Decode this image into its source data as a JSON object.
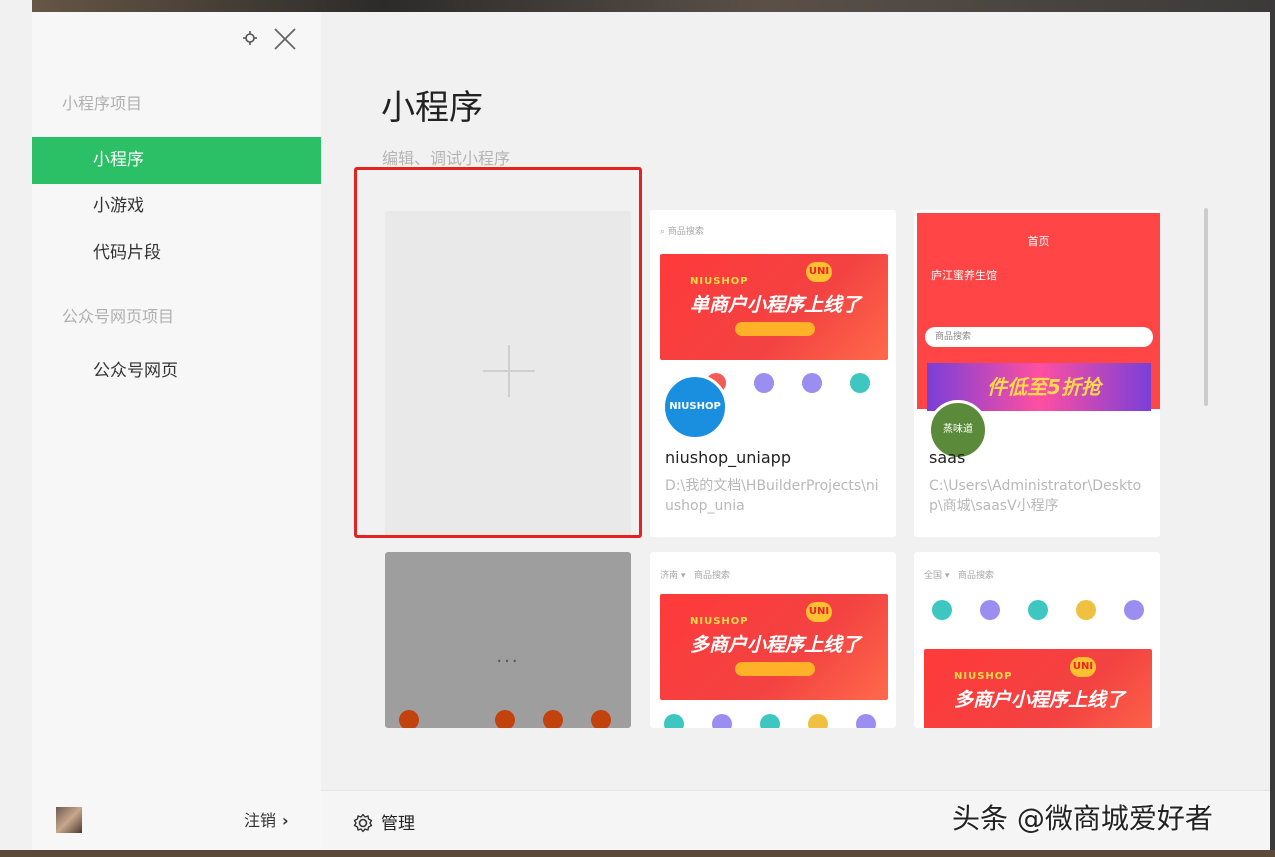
{
  "sidebar": {
    "section_mini": "小程序项目",
    "items": [
      {
        "label": "小程序"
      },
      {
        "label": "小游戏"
      },
      {
        "label": "代码片段"
      }
    ],
    "section_web": "公众号网页项目",
    "web_item": "公众号网页",
    "logout": "注销",
    "logout_chevron": "›"
  },
  "main": {
    "title": "小程序",
    "subtitle": "编辑、调试小程序",
    "projects": [
      {
        "name": "niushop_uniapp",
        "path": "D:\\我的文档\\HBuilderProjects\\niushop_unia",
        "logo": "NIUSHOP",
        "search": "商品搜索",
        "brand": "NIUSHOP",
        "banner": "单商户小程序上线了",
        "badge": "UNI"
      },
      {
        "name": "saas",
        "path": "C:\\Users\\Administrator\\Desktop\\商城\\saasV小程序",
        "header": "首页",
        "addr": "庐江蜜养生馆",
        "search": "商品搜索",
        "promo": "件低至5折抢",
        "logo": "蒸味道"
      }
    ],
    "loading_dots": "...",
    "multi_banner": "多商户小程序上线了",
    "multi_brand": "NIUSHOP",
    "multi_badge": "UNI",
    "multi_search_a": "商品搜索",
    "multi_loc_a": "济南",
    "multi_loc_b": "全国",
    "manage": "管理"
  },
  "watermark": "头条 @微商城爱好者",
  "colors": {
    "accent": "#2bbf66",
    "highlight": "#e32222"
  }
}
